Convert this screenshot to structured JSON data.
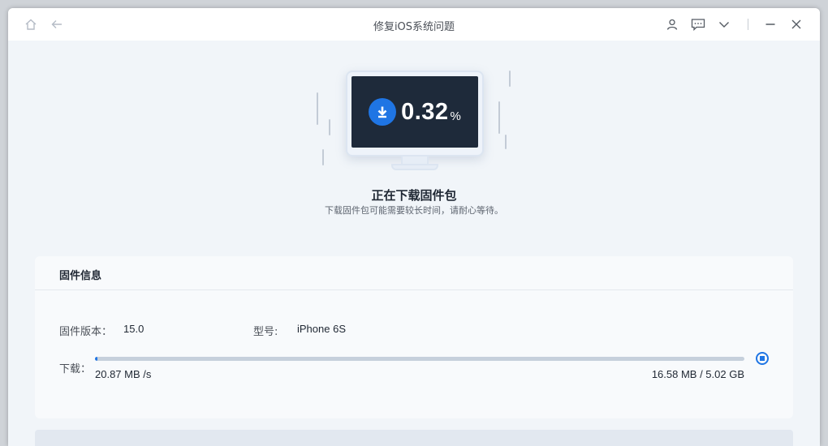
{
  "titlebar": {
    "title": "修复iOS系统问题",
    "icons": [
      "home-icon",
      "back-arrow-icon",
      "user-icon",
      "feedback-icon",
      "chevron-down-icon",
      "minimize-icon",
      "close-icon"
    ]
  },
  "progress": {
    "percent_value": "0.32",
    "percent_sign": "%",
    "fraction": 0.0032
  },
  "hero": {
    "title": "正在下载固件包",
    "subtitle": "下载固件包可能需要较长时间，请耐心等待。"
  },
  "firmware_card": {
    "title": "固件信息",
    "version_label": "固件版本：",
    "version_value": "15.0",
    "model_label": "型号:",
    "model_value": "iPhone 6S",
    "download_label": "下载：",
    "speed": "20.87 MB /s",
    "size": "16.58 MB / 5.02 GB"
  },
  "colors": {
    "accent": "#1f75e4",
    "screen": "#1e2a3a",
    "background": "#f1f5f9"
  }
}
